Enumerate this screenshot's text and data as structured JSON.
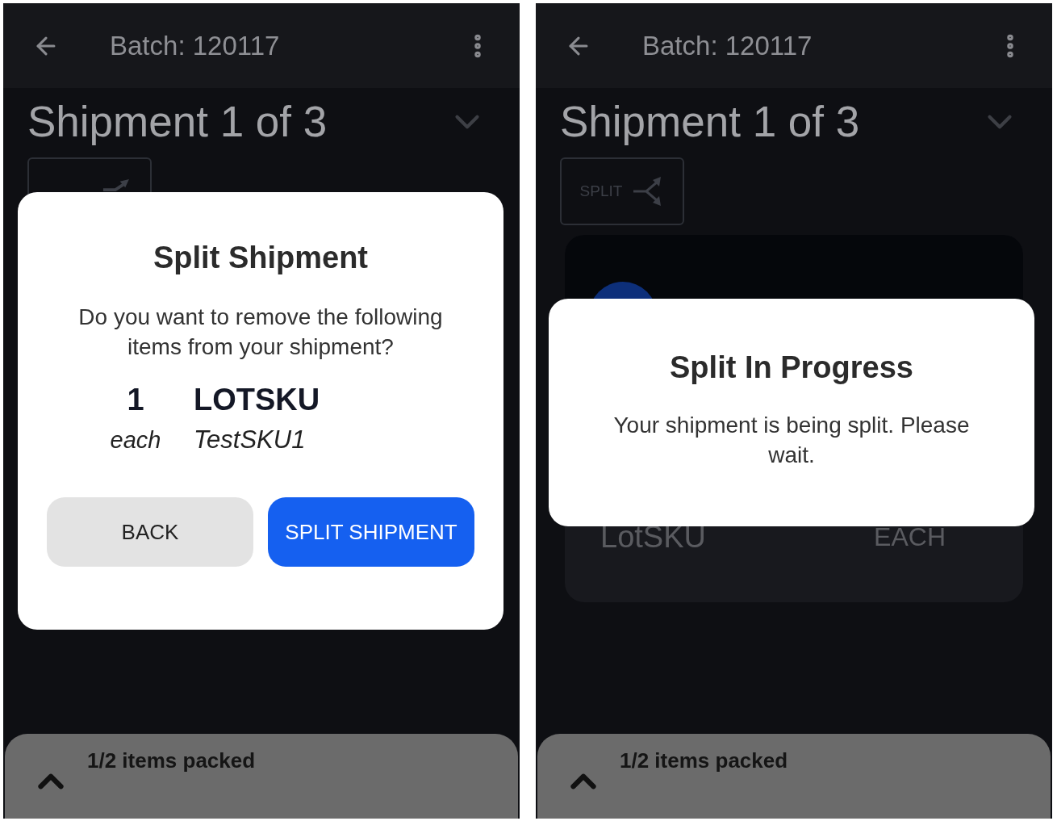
{
  "screens": [
    {
      "app_bar": {
        "title": "Batch: 120117"
      },
      "shipment_title": "Shipment 1 of 3",
      "split_button": {
        "covered": true
      },
      "dialog": {
        "kind": "confirm",
        "title": "Split Shipment",
        "message": "Do you want to remove the following items from your shipment?",
        "items": [
          {
            "quantity": "1",
            "unit": "each",
            "name": "LOTSKU",
            "sku": "TestSKU1"
          }
        ],
        "buttons": [
          {
            "label": "BACK",
            "kind": "secondary"
          },
          {
            "label": "SPLIT SHIPMENT",
            "kind": "primary"
          }
        ]
      },
      "footer": {
        "text": "1/2 items packed"
      }
    },
    {
      "app_bar": {
        "title": "Batch: 120117"
      },
      "shipment_title": "Shipment 1 of 3",
      "split_button": {
        "label": "SPLIT"
      },
      "card": {
        "name": "LotSKU",
        "unit": "EACH"
      },
      "dialog": {
        "kind": "progress",
        "title": "Split In Progress",
        "message": "Your shipment is being split. Please wait."
      },
      "footer": {
        "text": "1/2 items packed"
      }
    }
  ]
}
